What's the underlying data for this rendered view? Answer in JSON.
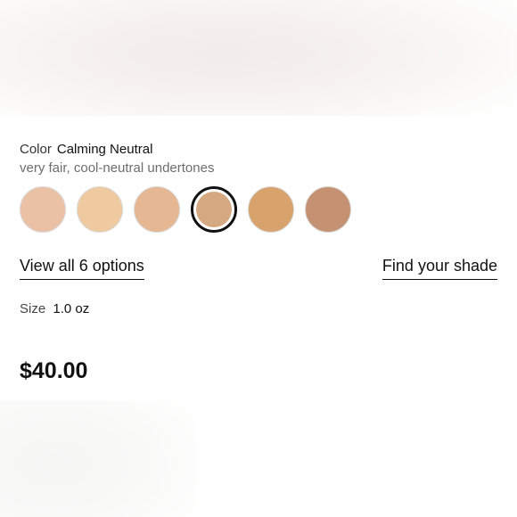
{
  "color": {
    "label": "Color",
    "value": "Calming Neutral",
    "description": "very fair, cool-neutral undertones"
  },
  "swatches": [
    {
      "color": "#ebc1a6",
      "selected": false
    },
    {
      "color": "#efc99f",
      "selected": false
    },
    {
      "color": "#e5b893",
      "selected": false
    },
    {
      "color": "#d4a880",
      "selected": true
    },
    {
      "color": "#d7a26c",
      "selected": false
    },
    {
      "color": "#c49272",
      "selected": false
    }
  ],
  "links": {
    "view_all": "View all 6 options",
    "find_shade": "Find your shade"
  },
  "size": {
    "label": "Size",
    "value": "1.0 oz"
  },
  "price": "$40.00"
}
